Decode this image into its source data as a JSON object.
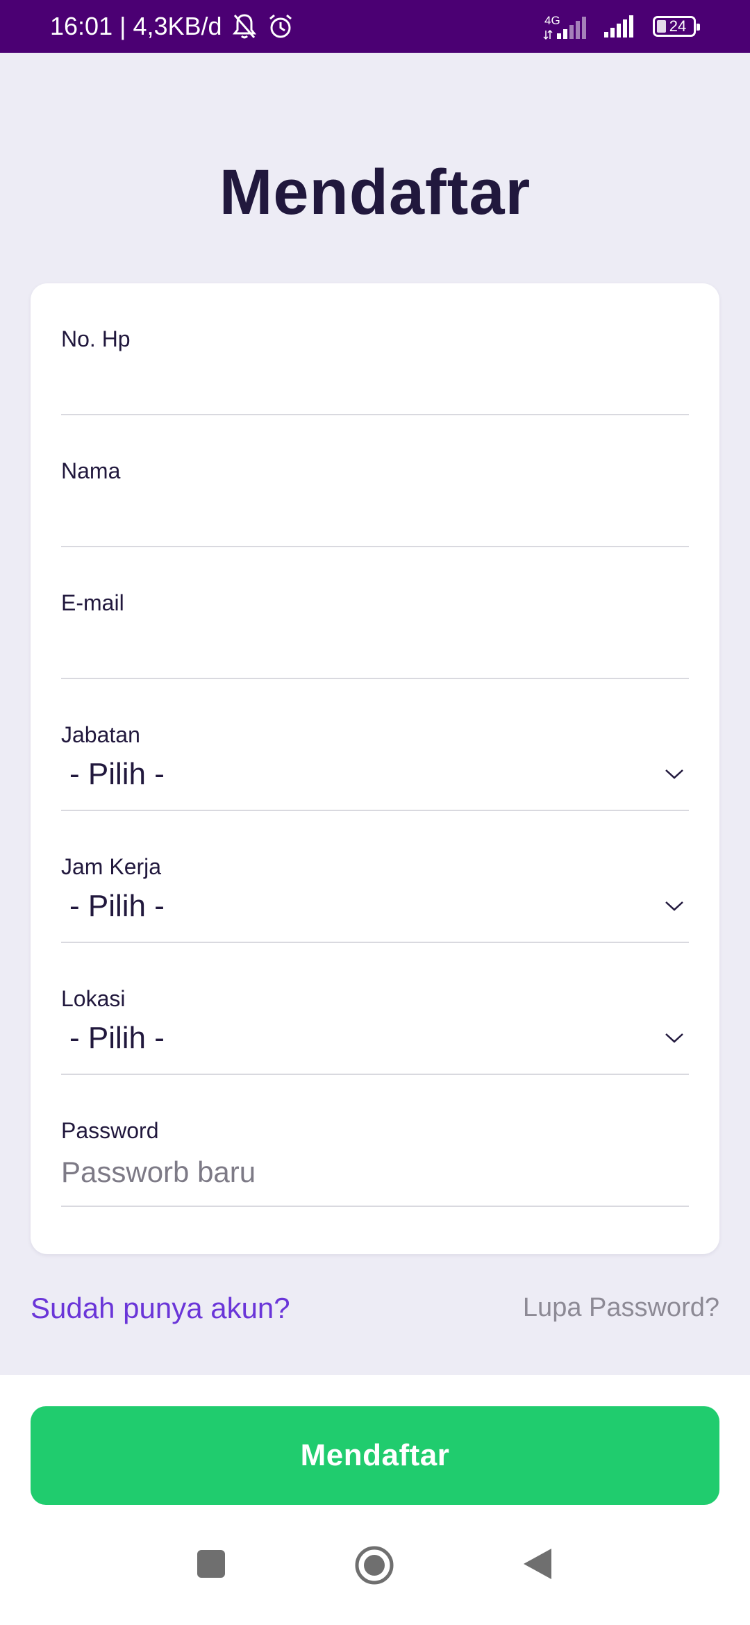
{
  "status_bar": {
    "time": "16:01",
    "separator": "|",
    "net_speed": "4,3KB/d",
    "network_type": "4G",
    "battery_level": "24",
    "icons": [
      "bell-muted-icon",
      "alarm-icon",
      "signal-4g-icon",
      "signal-icon",
      "battery-icon"
    ]
  },
  "page": {
    "title": "Mendaftar"
  },
  "form": {
    "phone": {
      "label": "No. Hp",
      "value": "",
      "placeholder": ""
    },
    "name": {
      "label": "Nama",
      "value": "",
      "placeholder": ""
    },
    "email": {
      "label": "E-mail",
      "value": "",
      "placeholder": ""
    },
    "position": {
      "label": "Jabatan",
      "selected": "- Pilih -"
    },
    "work_hours": {
      "label": "Jam Kerja",
      "selected": "- Pilih -"
    },
    "location": {
      "label": "Lokasi",
      "selected": "- Pilih -"
    },
    "password": {
      "label": "Password",
      "value": "",
      "placeholder": "Passworb baru"
    }
  },
  "links": {
    "login": "Sudah punya akun?",
    "forgot_password": "Lupa Password?"
  },
  "submit": {
    "label": "Mendaftar"
  },
  "nav": {
    "icons": [
      "recents-square-icon",
      "home-circle-icon",
      "back-triangle-icon"
    ]
  },
  "colors": {
    "status_bar": "#4b0073",
    "background": "#edecf5",
    "title": "#21183d",
    "link_accent": "#6a35d8",
    "muted_link": "#8d8a95",
    "primary_button": "#20cc6e"
  }
}
